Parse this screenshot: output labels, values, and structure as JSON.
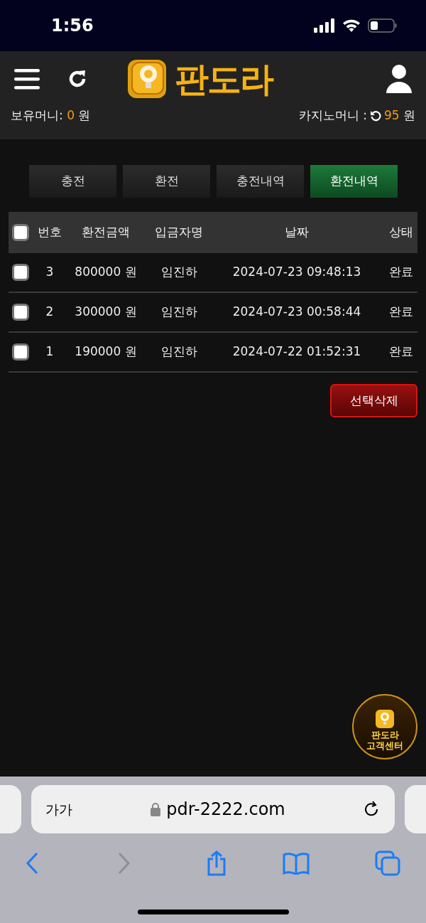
{
  "status_bar": {
    "time": "1:56"
  },
  "header": {
    "logo_text": "판도라",
    "wallet": {
      "label": "보유머니:",
      "amount": "0",
      "unit": "원"
    },
    "casino": {
      "label": "카지노머니 :",
      "amount": "95",
      "unit": "원"
    }
  },
  "tabs": [
    {
      "label": "충전",
      "selected": false
    },
    {
      "label": "환전",
      "selected": false
    },
    {
      "label": "충전내역",
      "selected": false
    },
    {
      "label": "환전내역",
      "selected": true
    }
  ],
  "table": {
    "select_all_checked": false,
    "columns": [
      "번호",
      "환전금액",
      "입금자명",
      "날짜",
      "상태"
    ],
    "rows": [
      {
        "checked": false,
        "cells": [
          "3",
          "800000 원",
          "임진하",
          "2024-07-23 09:48:13",
          "완료"
        ]
      },
      {
        "checked": false,
        "cells": [
          "2",
          "300000 원",
          "임진하",
          "2024-07-23 00:58:44",
          "완료"
        ]
      },
      {
        "checked": false,
        "cells": [
          "1",
          "190000 원",
          "임진하",
          "2024-07-22 01:52:31",
          "완료"
        ]
      }
    ]
  },
  "delete_button": "선택삭제",
  "support_badge": [
    "판도라",
    "고객센터"
  ],
  "browser": {
    "text_size": "가가",
    "url": "pdr-2222.com",
    "forward_disabled": true
  }
}
